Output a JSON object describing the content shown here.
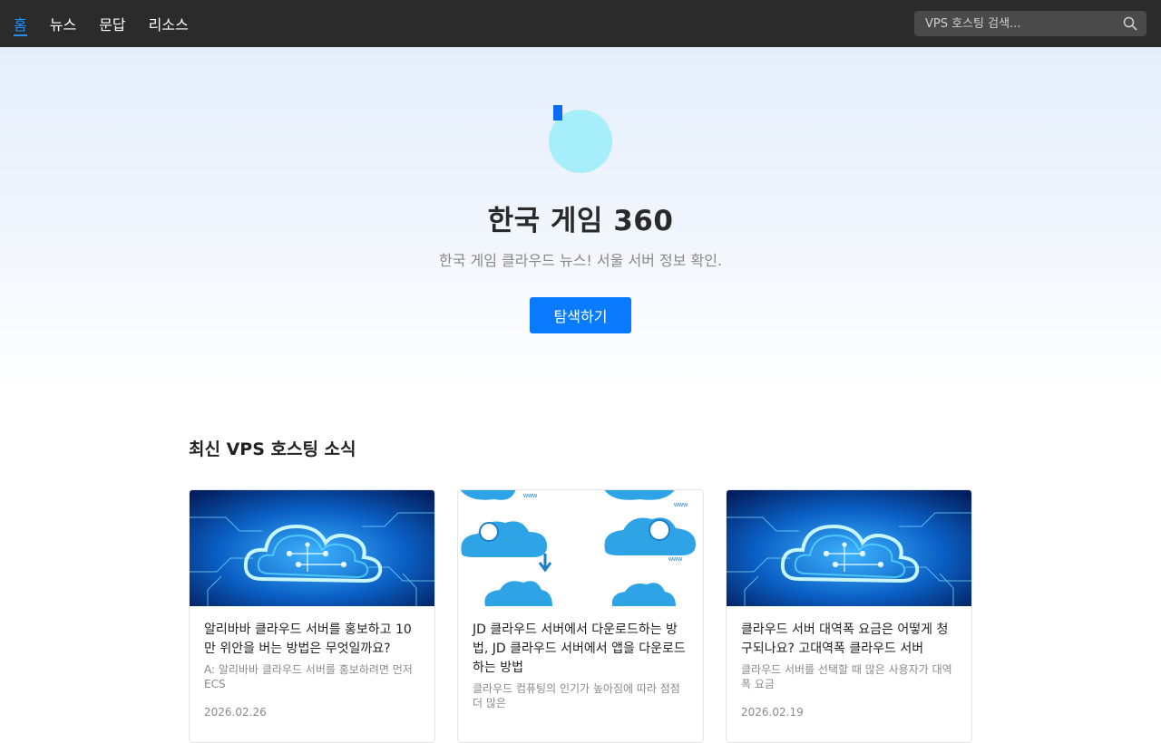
{
  "nav": {
    "items": [
      {
        "label": "홈",
        "active": true
      },
      {
        "label": "뉴스",
        "active": false
      },
      {
        "label": "문답",
        "active": false
      },
      {
        "label": "리소스",
        "active": false
      }
    ],
    "search": {
      "placeholder": "VPS 호스팅 검색...",
      "icon": "search-icon"
    }
  },
  "hero": {
    "title": "한국 게임 360",
    "subtitle": "한국 게임 클라우드 뉴스! 서울 서버 정보 확인.",
    "button_label": "탐색하기",
    "logo_color": "#a6eef9",
    "accent_color": "#0a7bff"
  },
  "section": {
    "title": "최신 VPS 호스팅 소식"
  },
  "cards": [
    {
      "title": "알리바바 클라우드 서버를 홍보하고 10만 위안을 버는 방법은 무엇일까요?",
      "excerpt": "A: 알리바바 클라우드 서버를 홍보하려면 먼저 ECS",
      "date": "2026.02.26",
      "image": "circuit-cloud"
    },
    {
      "title": "JD 클라우드 서버에서 다운로드하는 방법, JD 클라우드 서버에서 앱을 다운로드하는 방법",
      "excerpt": "클라우드 컴퓨팅의 인기가 높아짐에 따라 점점 더 많은",
      "date": "",
      "image": "cloud-globes"
    },
    {
      "title": "클라우드 서버 대역폭 요금은 어떻게 청구되나요? 고대역폭 클라우드 서버",
      "excerpt": "클라우드 서버를 선택할 때 많은 사용자가 대역폭 요금",
      "date": "2026.02.19",
      "image": "circuit-cloud"
    }
  ]
}
